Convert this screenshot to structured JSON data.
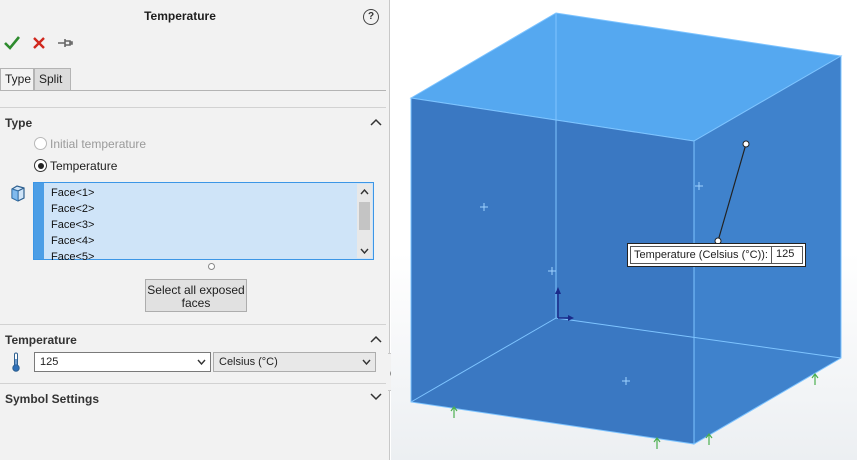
{
  "panel": {
    "title": "Temperature",
    "help_label": "?",
    "tabs": [
      {
        "label": "Type",
        "active": true
      },
      {
        "label": "Split",
        "active": false
      }
    ],
    "type_section": {
      "header": "Type",
      "options": [
        {
          "label": "Initial temperature",
          "selected": false,
          "enabled": false
        },
        {
          "label": "Temperature",
          "selected": true,
          "enabled": true
        }
      ],
      "faces": [
        "Face<1>",
        "Face<2>",
        "Face<3>",
        "Face<4>",
        "Face<5>"
      ],
      "select_button": "Select all exposed faces"
    },
    "temperature_section": {
      "header": "Temperature",
      "value": "125",
      "unit": "Celsius (°C)"
    },
    "symbol_section": {
      "header": "Symbol Settings"
    }
  },
  "viewport": {
    "callout_label": "Temperature (Celsius (°C)):",
    "callout_value": "125"
  },
  "colors": {
    "accent": "#4c9ee6",
    "cube_front": "#3a78c2",
    "cube_top": "#55a8f0",
    "cube_edge": "#7ec4ff",
    "ok": "#2e8b2e",
    "cancel": "#d0281e"
  },
  "icons": [
    "ok-check-icon",
    "cancel-x-icon",
    "pushpin-icon",
    "help-icon",
    "face-selection-icon",
    "thermometer-icon",
    "chevron-up-icon",
    "chevron-down-icon"
  ]
}
